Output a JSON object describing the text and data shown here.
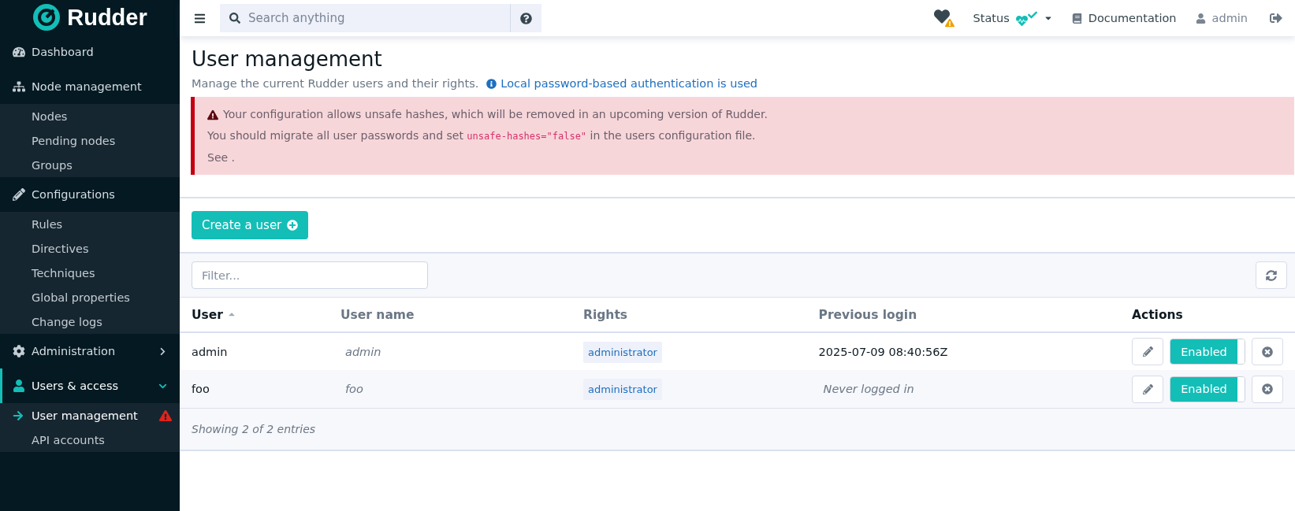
{
  "brand": {
    "name": "Rudder"
  },
  "topbar": {
    "search": {
      "placeholder": "Search anything"
    },
    "status": {
      "label": "Status",
      "warning": true
    },
    "documentation": "Documentation",
    "user": "admin"
  },
  "sidebar": {
    "sections": [
      {
        "label": "Dashboard",
        "expandable": false,
        "selected": false
      },
      {
        "label": "Node management",
        "expandable": false,
        "expanded": true,
        "selected": false,
        "children": [
          {
            "label": "Nodes",
            "selected": false,
            "warning": false
          },
          {
            "label": "Pending nodes",
            "selected": false,
            "warning": false
          },
          {
            "label": "Groups",
            "selected": false,
            "warning": false
          }
        ]
      },
      {
        "label": "Configurations",
        "expandable": false,
        "expanded": true,
        "selected": false,
        "children": [
          {
            "label": "Rules",
            "selected": false,
            "warning": false
          },
          {
            "label": "Directives",
            "selected": false,
            "warning": false
          },
          {
            "label": "Techniques",
            "selected": false,
            "warning": false
          },
          {
            "label": "Global properties",
            "selected": false,
            "warning": false
          },
          {
            "label": "Change logs",
            "selected": false,
            "warning": false
          }
        ]
      },
      {
        "label": "Administration",
        "expandable": true,
        "expanded": false,
        "selected": false
      },
      {
        "label": "Users & access",
        "expandable": true,
        "expanded": true,
        "selected": true,
        "children": [
          {
            "label": "User management",
            "selected": true,
            "warning": true
          },
          {
            "label": "API accounts",
            "selected": false,
            "warning": false
          }
        ]
      }
    ]
  },
  "page": {
    "title": "User management",
    "subtitle": "Manage the current Rudder users and their rights.",
    "auth_link": "Local password-based authentication is used",
    "alert": {
      "line1": "Your configuration allows unsafe hashes, which will be removed in an upcoming version of Rudder.",
      "line2_before": "You should migrate all user passwords and set",
      "line2_code": "unsafe-hashes=\"false\"",
      "line2_after": "in the users configuration file.",
      "line3": "See ."
    },
    "create_button": "Create a user",
    "filter": {
      "placeholder": "Filter..."
    }
  },
  "table": {
    "columns": [
      {
        "label": "User",
        "sorted": true
      },
      {
        "label": "User name",
        "sorted": false
      },
      {
        "label": "Rights",
        "sorted": false
      },
      {
        "label": "Previous login",
        "sorted": false
      },
      {
        "label": "Actions",
        "sorted": false
      }
    ],
    "rows": [
      {
        "user": "admin",
        "user_name": "admin",
        "rights": "administrator",
        "previous_login": "2025-07-09 08:40:56Z",
        "logged_in": true,
        "status": "Enabled",
        "on": true
      },
      {
        "user": "foo",
        "user_name": "foo",
        "rights": "administrator",
        "previous_login": "Never logged in",
        "logged_in": false,
        "status": "Enabled",
        "on": true
      }
    ],
    "footer": "Showing 2 of 2 entries"
  }
}
